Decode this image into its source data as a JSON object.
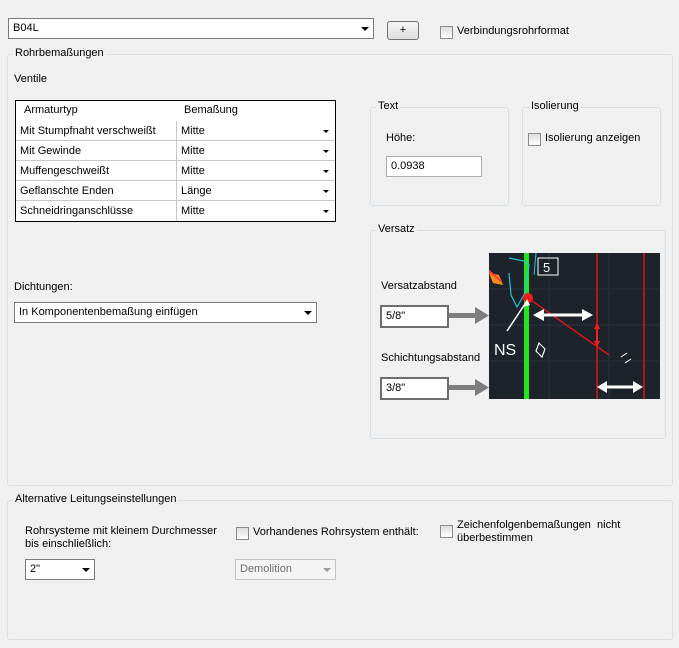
{
  "top": {
    "pipe_spec": "B04L",
    "add_button": "+",
    "connection_format_label": "Verbindungsrohrformat"
  },
  "rohr": {
    "title": "Rohrbemaßungen",
    "ventile_label": "Ventile",
    "table": {
      "headers": [
        "Armaturtyp",
        "Bemaßung"
      ],
      "rows": [
        {
          "type": "Mit Stumpfnaht verschweißt",
          "dim": "Mitte"
        },
        {
          "type": "Mit Gewinde",
          "dim": "Mitte"
        },
        {
          "type": "Muffengeschweißt",
          "dim": "Mitte"
        },
        {
          "type": "Geflanschte Enden",
          "dim": "Länge"
        },
        {
          "type": "Schneidringanschlüsse",
          "dim": "Mitte"
        }
      ]
    },
    "text_group": {
      "title": "Text",
      "height_label": "Höhe:",
      "height_value": "0.0938"
    },
    "isolierung": {
      "title": "Isolierung",
      "show_label": "Isolierung anzeigen"
    },
    "dichtungen": {
      "label": "Dichtungen:",
      "value": "In Komponentenbemaßung einfügen"
    },
    "versatz": {
      "title": "Versatz",
      "offset_label": "Versatzabstand",
      "offset_value": "5/8\"",
      "stack_label": "Schichtungsabstand",
      "stack_value": "3/8\"",
      "preview_number": "5",
      "preview_ns": "NS"
    }
  },
  "alt": {
    "title": "Alternative Leitungseinstellungen",
    "small_pipe_label_1": "Rohrsysteme mit kleinem Durchmesser",
    "small_pipe_label_2": "bis einschließlich:",
    "small_pipe_value": "2\"",
    "existing_label": "Vorhandenes Rohrsystem enthält:",
    "existing_value": "Demolition",
    "string_label_1": "Zeichenfolgenbemaßungen  nicht",
    "string_label_2": "überbestimmen"
  },
  "colors": {
    "preview_bg": "#1c232b",
    "pipe_green": "#22e51f",
    "marker_red": "#ff1a1a",
    "cyan": "#25c6d6"
  }
}
